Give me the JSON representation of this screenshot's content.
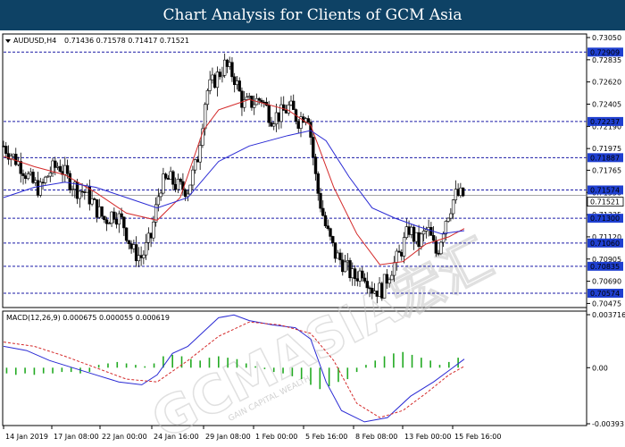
{
  "title": "Chart Analysis for Clients of GCM Asia",
  "watermark": {
    "brand": "GCMASIA宏汇",
    "tagline": "GAIN CAPITAL WEALTH"
  },
  "chart_data": [
    {
      "type": "candlestick",
      "symbol_label": "AUDUSD,H4",
      "ohlc_label": "0.71436 0.71578 0.71417 0.71521",
      "ylim": [
        0.7047,
        0.7305
      ],
      "y_ticks": [
        "0.73050",
        "0.72835",
        "0.72620",
        "0.72405",
        "0.72190",
        "0.71975",
        "0.71765",
        "0.71550",
        "0.71335",
        "0.71120",
        "0.70905",
        "0.70690",
        "0.70475"
      ],
      "y_tick_values": [
        0.7305,
        0.72835,
        0.7262,
        0.72405,
        0.7219,
        0.71975,
        0.71765,
        0.7155,
        0.71335,
        0.7112,
        0.70905,
        0.7069,
        0.70475
      ],
      "levels": [
        0.72909,
        0.72237,
        0.71887,
        0.71574,
        0.713,
        0.7106,
        0.70835,
        0.70574
      ],
      "level_labels": [
        "0.72909",
        "0.72237",
        "0.71887",
        "0.71574",
        "0.71300",
        "0.71060",
        "0.70835",
        "0.70574"
      ],
      "current_price": 0.71521,
      "current_price_label": "0.71521",
      "x_tick_labels": [
        "14 Jan 2019",
        "17 Jan 08:00",
        "22 Jan 00:00",
        "24 Jan 16:00",
        "29 Jan 08:00",
        "1 Feb 00:00",
        "5 Feb 16:00",
        "8 Feb 08:00",
        "13 Feb 00:00",
        "15 Feb 16:00"
      ],
      "close_path": [
        [
          0,
          0.72
        ],
        [
          6,
          0.719
        ],
        [
          12,
          0.718
        ],
        [
          18,
          0.7165
        ],
        [
          24,
          0.7158
        ],
        [
          30,
          0.7175
        ],
        [
          36,
          0.7182
        ],
        [
          42,
          0.7168
        ],
        [
          48,
          0.7158
        ],
        [
          54,
          0.7155
        ],
        [
          60,
          0.714
        ],
        [
          66,
          0.7128
        ],
        [
          72,
          0.7136
        ],
        [
          78,
          0.7125
        ],
        [
          84,
          0.7098
        ],
        [
          90,
          0.7092
        ],
        [
          96,
          0.7112
        ],
        [
          102,
          0.7162
        ],
        [
          108,
          0.7168
        ],
        [
          114,
          0.716
        ],
        [
          120,
          0.7158
        ],
        [
          126,
          0.7185
        ],
        [
          132,
          0.7252
        ],
        [
          138,
          0.7265
        ],
        [
          144,
          0.7278
        ],
        [
          150,
          0.7268
        ],
        [
          156,
          0.724
        ],
        [
          162,
          0.7242
        ],
        [
          168,
          0.7246
        ],
        [
          174,
          0.7228
        ],
        [
          180,
          0.723
        ],
        [
          186,
          0.7238
        ],
        [
          192,
          0.7225
        ],
        [
          198,
          0.7235
        ],
        [
          204,
          0.716
        ],
        [
          210,
          0.712
        ],
        [
          216,
          0.7095
        ],
        [
          222,
          0.7085
        ],
        [
          228,
          0.7072
        ],
        [
          234,
          0.708
        ],
        [
          240,
          0.7062
        ],
        [
          246,
          0.706
        ],
        [
          252,
          0.708
        ],
        [
          258,
          0.7095
        ],
        [
          264,
          0.712
        ],
        [
          270,
          0.7105
        ],
        [
          276,
          0.712
        ],
        [
          282,
          0.7095
        ],
        [
          288,
          0.713
        ],
        [
          294,
          0.7152
        ]
      ],
      "ma_red": [
        [
          0,
          0.719
        ],
        [
          20,
          0.718
        ],
        [
          40,
          0.7172
        ],
        [
          60,
          0.7155
        ],
        [
          80,
          0.7135
        ],
        [
          100,
          0.7128
        ],
        [
          115,
          0.715
        ],
        [
          130,
          0.7215
        ],
        [
          140,
          0.7235
        ],
        [
          160,
          0.7245
        ],
        [
          185,
          0.7235
        ],
        [
          200,
          0.722
        ],
        [
          215,
          0.716
        ],
        [
          230,
          0.7115
        ],
        [
          245,
          0.7085
        ],
        [
          260,
          0.7088
        ],
        [
          275,
          0.7105
        ],
        [
          290,
          0.7112
        ],
        [
          300,
          0.712
        ]
      ],
      "ma_blue": [
        [
          0,
          0.715
        ],
        [
          20,
          0.716
        ],
        [
          40,
          0.7165
        ],
        [
          60,
          0.716
        ],
        [
          80,
          0.715
        ],
        [
          100,
          0.714
        ],
        [
          120,
          0.715
        ],
        [
          140,
          0.7185
        ],
        [
          160,
          0.72
        ],
        [
          185,
          0.721
        ],
        [
          200,
          0.7215
        ],
        [
          210,
          0.7205
        ],
        [
          225,
          0.717
        ],
        [
          240,
          0.714
        ],
        [
          255,
          0.713
        ],
        [
          270,
          0.7122
        ],
        [
          285,
          0.7115
        ],
        [
          300,
          0.7118
        ]
      ],
      "x_max": 300
    },
    {
      "type": "macd",
      "label": "MACD(12,26,9) 0.000675 0.000055 0.000619",
      "ylim": [
        -0.00393,
        0.003716
      ],
      "y_ticks": [
        "0.003716",
        "0.00",
        "-0.00393"
      ],
      "y_tick_values": [
        0.003716,
        0.0,
        -0.00393
      ],
      "macd_line": [
        [
          0,
          0.0015
        ],
        [
          15,
          0.0012
        ],
        [
          30,
          0.0005
        ],
        [
          45,
          0.0
        ],
        [
          60,
          -0.0005
        ],
        [
          75,
          -0.001
        ],
        [
          90,
          -0.0012
        ],
        [
          100,
          -0.0005
        ],
        [
          110,
          0.001
        ],
        [
          120,
          0.0015
        ],
        [
          130,
          0.0025
        ],
        [
          140,
          0.0035
        ],
        [
          150,
          0.0037
        ],
        [
          160,
          0.0033
        ],
        [
          175,
          0.003
        ],
        [
          190,
          0.0028
        ],
        [
          200,
          0.002
        ],
        [
          210,
          -0.001
        ],
        [
          220,
          -0.003
        ],
        [
          235,
          -0.0038
        ],
        [
          250,
          -0.0035
        ],
        [
          265,
          -0.002
        ],
        [
          280,
          -0.001
        ],
        [
          290,
          -0.0002
        ],
        [
          300,
          0.0006
        ]
      ],
      "signal_line": [
        [
          0,
          0.0018
        ],
        [
          20,
          0.0015
        ],
        [
          40,
          0.0008
        ],
        [
          60,
          0.0
        ],
        [
          80,
          -0.0008
        ],
        [
          100,
          -0.001
        ],
        [
          120,
          0.0005
        ],
        [
          140,
          0.0022
        ],
        [
          160,
          0.0032
        ],
        [
          180,
          0.003
        ],
        [
          200,
          0.0024
        ],
        [
          215,
          0.0005
        ],
        [
          230,
          -0.0025
        ],
        [
          245,
          -0.0035
        ],
        [
          260,
          -0.003
        ],
        [
          275,
          -0.0018
        ],
        [
          290,
          -0.0005
        ],
        [
          300,
          0.0001
        ]
      ],
      "histogram": [
        [
          2,
          -0.0004
        ],
        [
          8,
          -0.0005
        ],
        [
          14,
          -0.0004
        ],
        [
          20,
          -0.0005
        ],
        [
          26,
          -0.0004
        ],
        [
          32,
          -0.0004
        ],
        [
          38,
          -0.0003
        ],
        [
          44,
          -0.0003
        ],
        [
          50,
          -0.0004
        ],
        [
          56,
          -0.0003
        ],
        [
          62,
          0.0002
        ],
        [
          68,
          0.0003
        ],
        [
          74,
          0.0004
        ],
        [
          80,
          0.0003
        ],
        [
          86,
          0.0002
        ],
        [
          92,
          0.0001
        ],
        [
          98,
          0.0003
        ],
        [
          104,
          0.0008
        ],
        [
          110,
          0.0009
        ],
        [
          116,
          0.0008
        ],
        [
          122,
          0.0006
        ],
        [
          128,
          0.0005
        ],
        [
          134,
          0.0007
        ],
        [
          140,
          0.0008
        ],
        [
          146,
          0.0007
        ],
        [
          152,
          0.0006
        ],
        [
          158,
          0.0003
        ],
        [
          164,
          0.0001
        ],
        [
          170,
          -0.0001
        ],
        [
          176,
          -0.0003
        ],
        [
          182,
          -0.0004
        ],
        [
          188,
          -0.0006
        ],
        [
          194,
          -0.0008
        ],
        [
          200,
          -0.0012
        ],
        [
          206,
          -0.0015
        ],
        [
          212,
          -0.0013
        ],
        [
          218,
          -0.001
        ],
        [
          224,
          -0.0008
        ],
        [
          230,
          -0.0003
        ],
        [
          236,
          0.0002
        ],
        [
          242,
          0.0005
        ],
        [
          248,
          0.0008
        ],
        [
          254,
          0.001
        ],
        [
          260,
          0.0011
        ],
        [
          266,
          0.0009
        ],
        [
          272,
          0.0007
        ],
        [
          278,
          0.0005
        ],
        [
          284,
          0.0002
        ],
        [
          290,
          0.0004
        ],
        [
          296,
          0.0007
        ]
      ],
      "x_max": 300
    }
  ]
}
